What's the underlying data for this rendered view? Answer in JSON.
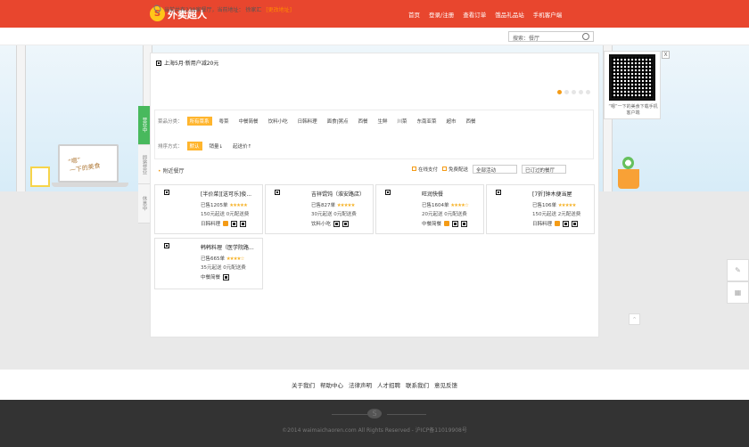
{
  "header": {
    "brand": "外卖超人",
    "nav": [
      "首页",
      "登录/注册",
      "查看订单",
      "饿品礼品站",
      "手机客户端"
    ]
  },
  "location": {
    "text": "当前共有238家餐厅，当前地址：",
    "address": "徐家汇",
    "change": "[更改地址]"
  },
  "search": {
    "placeholder": "搜索：餐厅"
  },
  "banner": {
    "notice": "上海5月·新用户减20元"
  },
  "qr": {
    "close": "X",
    "text": "“嗯”一下的美食下载手机客户端"
  },
  "sidebar_tabs": [
    "营业中",
    "即将营业",
    "休息中"
  ],
  "filters": {
    "category_label": "菜品分类：",
    "categories": [
      "所有菜系",
      "粤菜",
      "中餐简餐",
      "饮料小吃",
      "日韩料理",
      "面食|粥点",
      "西餐",
      "生鲜",
      "川菜",
      "东南亚菜",
      "超市",
      "西餐"
    ],
    "sort_label": "排序方式：",
    "sorts": [
      "默认",
      "销量↓",
      "起送价↑"
    ]
  },
  "section": {
    "title": "附近餐厅",
    "online_pay": "在线支付",
    "free_delivery": "免费配送",
    "activity": "全部活动",
    "ordered": "已订过的餐厅"
  },
  "restaurants": [
    {
      "name": "[半价菜][送可乐]俊...",
      "sales": "已售1205单",
      "stars": "★★★★★",
      "delivery": "150元起送 0元配送费",
      "category": "日韩料理"
    },
    {
      "name": "吉祥馄饨（淮安路店）",
      "sales": "已售827单",
      "stars": "★★★★★",
      "delivery": "30元起送 0元配送费",
      "category": "饮料小吃"
    },
    {
      "name": "旺润快餐",
      "sales": "已售1604单",
      "stars": "★★★★☆",
      "delivery": "20元起送 0元配送费",
      "category": "中餐简餐"
    },
    {
      "name": "[7折]钟木便当屋",
      "sales": "已售106单",
      "stars": "★★★★★",
      "delivery": "150元起送 2元配送费",
      "category": "日韩料理"
    },
    {
      "name": "韩韩料理（医学院路...",
      "sales": "已售665单",
      "stars": "★★★★☆",
      "delivery": "35元起送 0元配送费",
      "category": "中餐简餐"
    }
  ],
  "footer": {
    "links": [
      "关于我们",
      "帮助中心",
      "法律声明",
      "人才招聘",
      "联系我们",
      "意见反馈"
    ],
    "copyright": "©2014 waimaichaoren.com All Rights Reserved - 沪ICP备11019908号"
  }
}
